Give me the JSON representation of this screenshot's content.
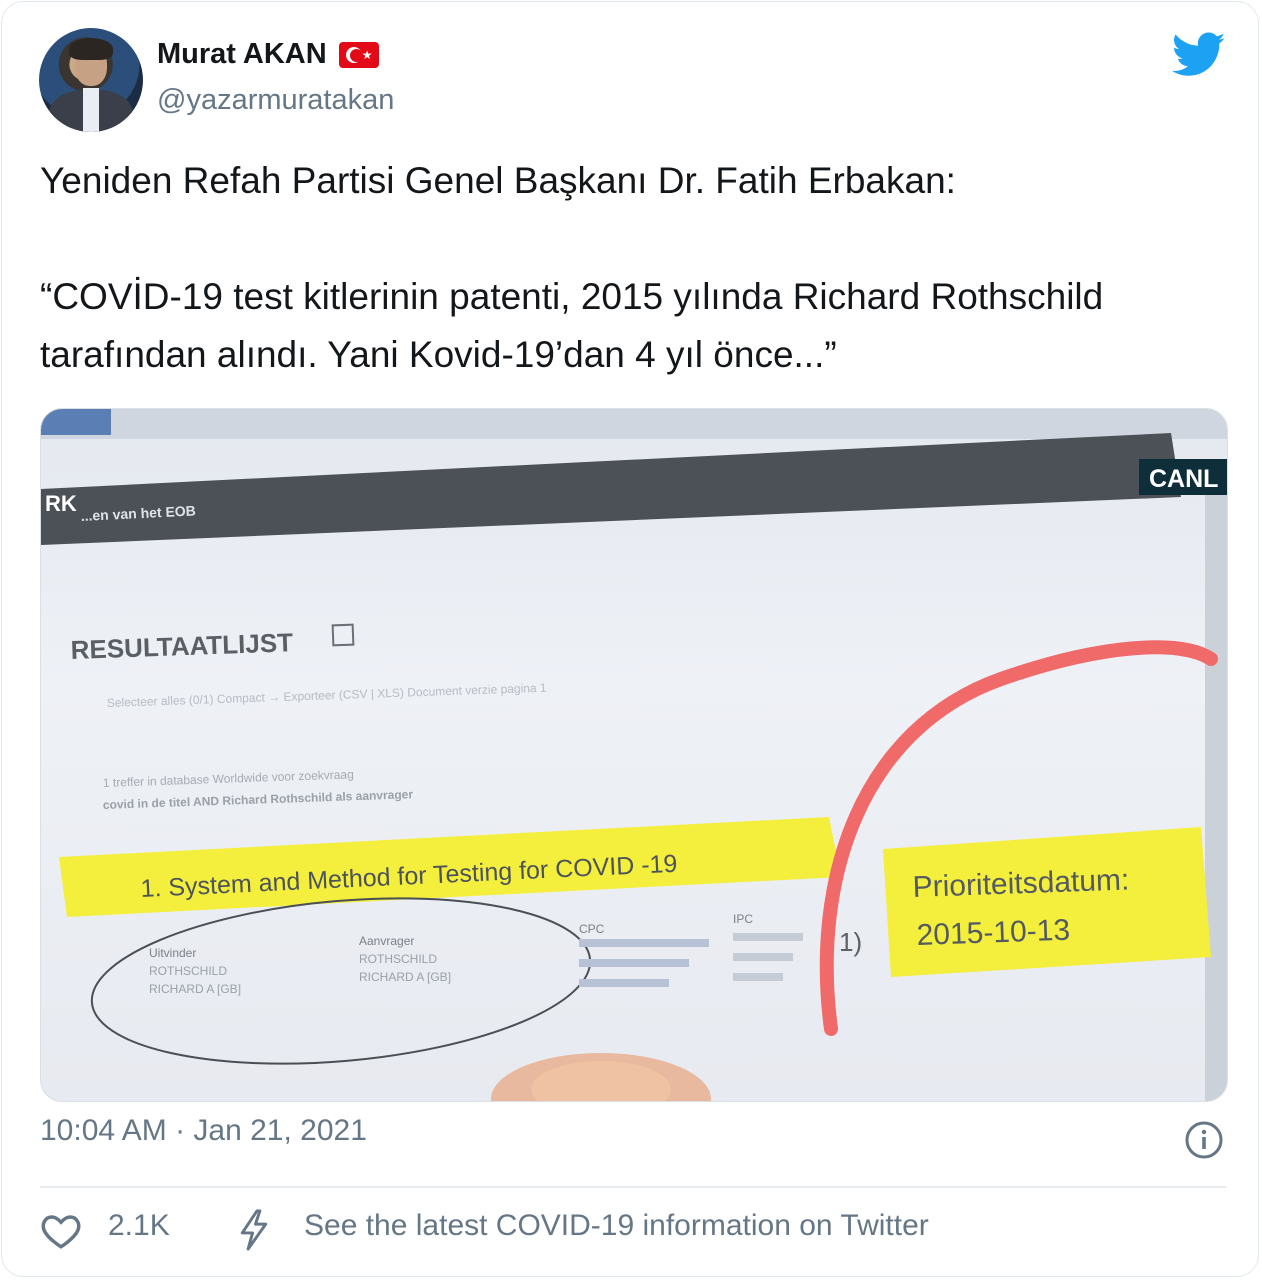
{
  "author": {
    "name": "Murat AKAN",
    "handle": "@yazarmuratakan"
  },
  "tweet": {
    "line1": "Yeniden Refah Partisi Genel Başkanı Dr. Fatih Erbakan:",
    "quote": "“COVİD-19 test kitlerinin patenti, 2015 yılında Richard Rothschild tarafından alındı. Yani Kovid-19’dan 4 yıl önce...”"
  },
  "media": {
    "live_badge": "CANL",
    "menu_text": "RK",
    "dropdown_text": "...en van het EOB",
    "results_heading": "RESULTAATLIJST",
    "toolbar": "Selecteer alles (0/1)   Compact   → Exporteer (CSV | XLS)   Document verzie pagina 1",
    "result_note_1": "1 treffer in database Worldwide voor zoekvraag",
    "result_note_2": "covid in de titel AND Richard Rothschild als aanvrager",
    "highlight_title": "1.  System and Method for Testing for  COVID -19",
    "inventor_label": "Uitvinder",
    "inventor_1": "ROTHSCHILD",
    "inventor_2": "RICHARD A [GB]",
    "applicant_label": "Aanvrager",
    "applicant_1": "ROTHSCHILD",
    "applicant_2": "RICHARD A [GB]",
    "cpc_label": "CPC",
    "ipc_label": "IPC",
    "number_fragment": "1)",
    "priority_label": "Prioriteitsdatum:",
    "priority_date": "2015-10-13"
  },
  "meta": {
    "timestamp": "10:04 AM · Jan 21, 2021"
  },
  "actions": {
    "likes": "2.1K",
    "covid_info": "See the latest COVID-19 information on Twitter"
  },
  "colors": {
    "twitter_blue": "#1da1f2",
    "secondary_text": "#657786",
    "highlight_yellow": "#f4ef3c",
    "annotation_red": "#f06a6a"
  },
  "icons": [
    "twitter-bird-icon",
    "turkey-flag-icon",
    "info-icon",
    "heart-icon",
    "lightning-icon"
  ]
}
